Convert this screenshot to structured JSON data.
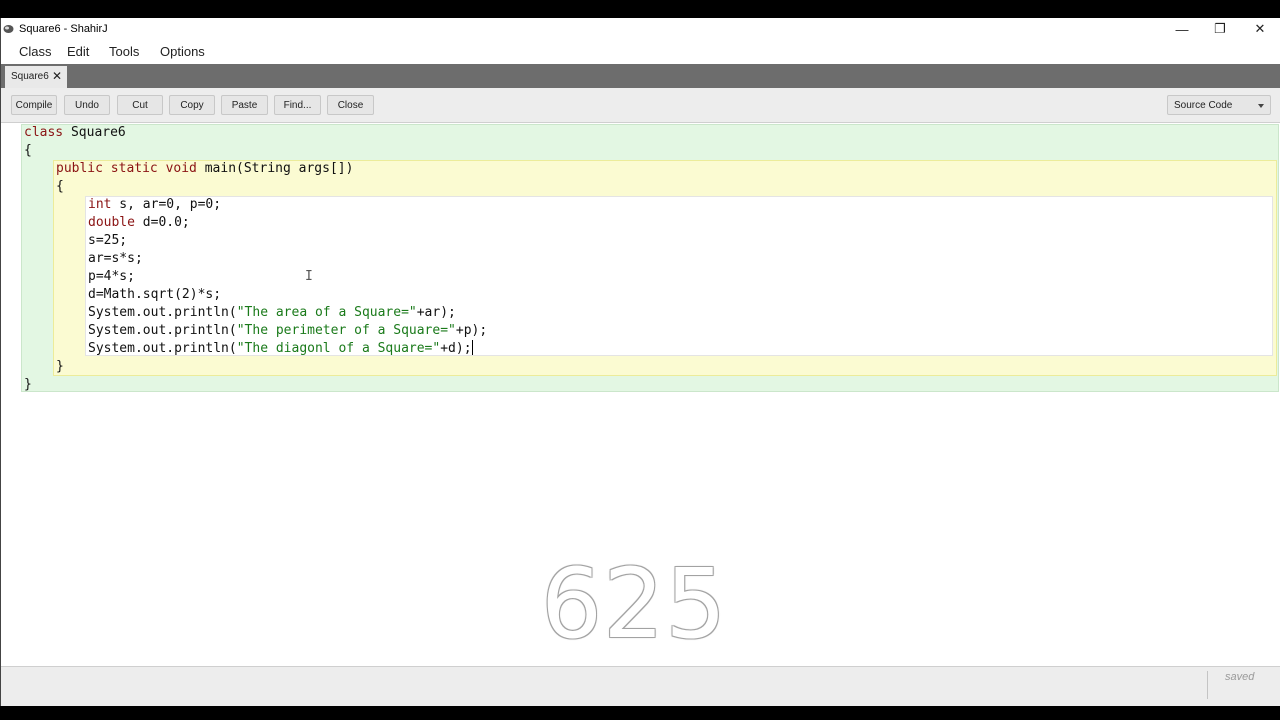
{
  "window": {
    "title": "Square6 - ShahirJ",
    "controls": {
      "minimize": "—",
      "maximize": "❐",
      "close": "✕"
    }
  },
  "menu": [
    "Class",
    "Edit",
    "Tools",
    "Options"
  ],
  "tab": {
    "label": "Square6",
    "close": "✕"
  },
  "toolbar": {
    "buttons": [
      "Compile",
      "Undo",
      "Cut",
      "Copy",
      "Paste",
      "Find...",
      "Close"
    ],
    "view_select": "Source Code"
  },
  "code": {
    "l1": {
      "kw": "class",
      "rest": " Square6"
    },
    "l2": "{",
    "l3": {
      "kw": "public static void",
      "rest": " main(String args[])"
    },
    "l4": "{",
    "l5": {
      "kw": "int",
      "rest": " s, ar=0, p=0;"
    },
    "l6": {
      "kw": "double",
      "rest": " d=0.0;"
    },
    "l7": "s=25;",
    "l8": "ar=s*s;",
    "l9": "p=4*s;",
    "l10": "d=Math.sqrt(2)*s;",
    "l11": {
      "pre": "System.out.println(",
      "str": "\"The area of a Square=\"",
      "post": "+ar);"
    },
    "l12": {
      "pre": "System.out.println(",
      "str": "\"The perimeter of a Square=\"",
      "post": "+p);"
    },
    "l13": {
      "pre": "System.out.println(",
      "str": "\"The diagonl of a Square=\"",
      "post": "+d);"
    },
    "l14": "}",
    "l15": "}"
  },
  "overlay_value": "625",
  "status": {
    "saved": "saved"
  },
  "colors": {
    "keyword": "#8b1414",
    "string": "#1a7a1a",
    "class_scope": "#e3f7e3",
    "method_scope": "#fbfbd2"
  }
}
